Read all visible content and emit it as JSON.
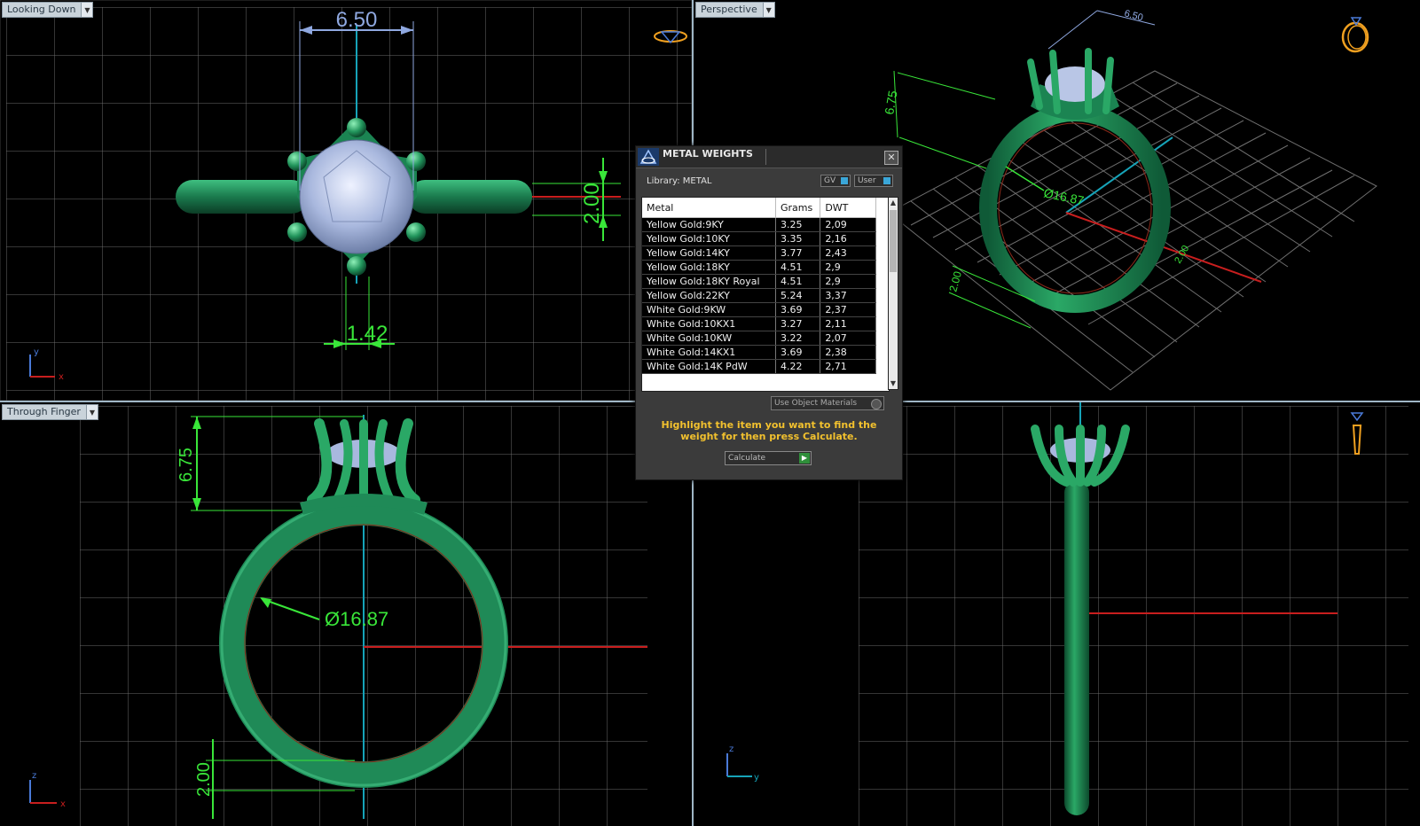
{
  "viewports": {
    "top_left": {
      "label": "Looking Down",
      "dims": {
        "width": "6.50",
        "prong": "1.42",
        "height": "2.00"
      },
      "axes": [
        "y",
        "x"
      ]
    },
    "top_right": {
      "label": "Perspective",
      "dims": {
        "width": "6.50",
        "height": "6.75",
        "diameter": "Ø16.87",
        "band": "2.00",
        "band2": "2.00"
      }
    },
    "bottom_left": {
      "label": "Through Finger",
      "dims": {
        "height": "6.75",
        "diameter": "Ø16.87",
        "band": "2.00"
      },
      "axes": [
        "z",
        "x"
      ]
    },
    "bottom_right": {
      "axes": [
        "z",
        "y"
      ]
    }
  },
  "dialog": {
    "title": "METAL WEIGHTS",
    "close_icon": "close-icon",
    "library_label": "Library: METAL",
    "toggle_gv": "GV",
    "toggle_user": "User",
    "columns": [
      "Metal",
      "Grams",
      "DWT"
    ],
    "rows": [
      [
        "Yellow Gold:9KY",
        "3.25",
        "2,09"
      ],
      [
        "Yellow Gold:10KY",
        "3.35",
        "2,16"
      ],
      [
        "Yellow Gold:14KY",
        "3.77",
        "2,43"
      ],
      [
        "Yellow Gold:18KY",
        "4.51",
        "2,9"
      ],
      [
        "Yellow Gold:18KY Royal",
        "4.51",
        "2,9"
      ],
      [
        "Yellow Gold:22KY",
        "5.24",
        "3,37"
      ],
      [
        "White Gold:9KW",
        "3.69",
        "2,37"
      ],
      [
        "White Gold:10KX1",
        "3.27",
        "2,11"
      ],
      [
        "White Gold:10KW",
        "3.22",
        "2,07"
      ],
      [
        "White Gold:14KX1",
        "3.69",
        "2,38"
      ],
      [
        "White Gold:14K PdW",
        "4.22",
        "2,71"
      ]
    ],
    "use_object_materials": "Use Object Materials",
    "hint": "Highlight the item you want to find the weight for then press Calculate.",
    "calculate_label": "Calculate"
  },
  "colors": {
    "metal": "#1f8a57",
    "metal_highlight": "#49c486",
    "stone": "#b9c6e6",
    "grid": "#6f6f6f",
    "dimension": "#39e639",
    "dimension_blue": "#8fa8e0",
    "hint": "#f2c12e"
  }
}
